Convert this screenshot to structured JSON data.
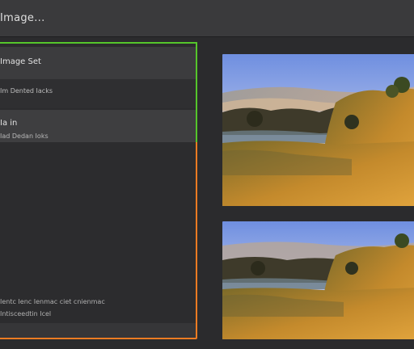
{
  "header": {
    "title": "Image..."
  },
  "panel": {
    "rows": [
      {
        "primary": "Image Set"
      },
      {
        "secondary": "Im  Dented  Iacks"
      },
      {
        "primary": "Ia  in",
        "secondary": "Iad  Dedan Ioks"
      }
    ],
    "footer_lines": [
      "Ientc  Ienc  Ienmac  ciet  cnienmac",
      "Intisceedtin  Icel"
    ]
  },
  "images": [
    {
      "name": "landscape-preview-1"
    },
    {
      "name": "landscape-preview-2"
    }
  ],
  "colors": {
    "selection_outline": "#f07c22",
    "active_outline": "#55c62b",
    "background": "#2b2b2d"
  }
}
